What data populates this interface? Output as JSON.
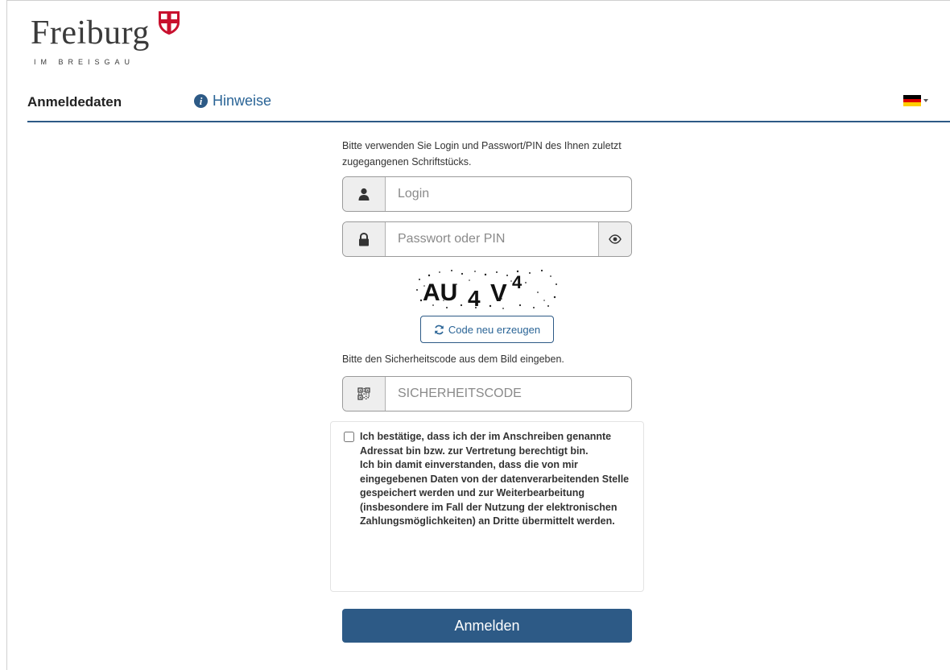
{
  "logo": {
    "name": "Freiburg",
    "subtitle": "IM BREISGAU"
  },
  "nav": {
    "tab_login": "Anmeldedaten",
    "tab_hints": "Hinweise",
    "language": "de"
  },
  "colors": {
    "primary": "#2d5a86",
    "link": "#2a6496",
    "shield_red": "#c8102e"
  },
  "form": {
    "intro": "Bitte verwenden Sie Login und Passwort/PIN des Ihnen zuletzt zugegangenen Schriftstücks.",
    "login_placeholder": "Login",
    "password_placeholder": "Passwort oder PIN",
    "captcha_text": "AU4V4",
    "refresh_label": "Code neu erzeugen",
    "security_hint": "Bitte den Sicherheitscode aus dem Bild eingeben.",
    "security_placeholder": "SICHERHEITSCODE",
    "consent_text": "Ich bestätige, dass ich der im Anschreiben genannte Adressat bin bzw. zur Vertretung berechtigt bin.\nIch bin damit einverstanden, dass die von mir eingegebenen Daten von der datenverarbeitenden Stelle gespeichert werden und zur Weiterbearbeitung (insbesondere im Fall der Nutzung der elektronischen Zahlungsmöglichkeiten) an Dritte übermittelt werden.",
    "consent_checked": false,
    "submit_label": "Anmelden"
  },
  "icons": {
    "login": "user-icon",
    "password": "lock-icon",
    "show_password": "eye-icon",
    "security": "qr-code-icon",
    "refresh": "refresh-icon",
    "hints": "info-icon"
  }
}
